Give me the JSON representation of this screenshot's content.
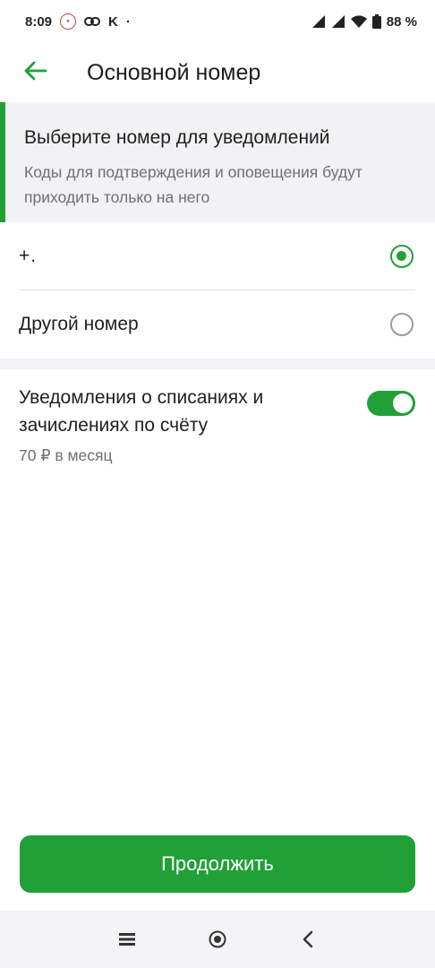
{
  "status_bar": {
    "time": "8:09",
    "carrier_letter": "K",
    "dot": "·",
    "battery": "88 %"
  },
  "header": {
    "title": "Основной номер",
    "back_icon": "arrow-left-icon"
  },
  "info": {
    "title": "Выберите номер для уведомлений",
    "description": "Коды для подтверждения и оповещения будут приходить только на него"
  },
  "options": [
    {
      "label": "+. ",
      "selected": true
    },
    {
      "label": "Другой номер",
      "selected": false
    }
  ],
  "notifications": {
    "title": "Уведомления о списаниях и зачислениях по счёту",
    "price": "70 ₽ в месяц",
    "enabled": true
  },
  "cta": {
    "label": "Продолжить"
  },
  "colors": {
    "accent": "#21a038",
    "background": "#f3f3f5",
    "text_secondary": "#6f6f74"
  },
  "system_nav": {
    "icons": [
      "menu-icon",
      "home-icon",
      "back-chevron-icon"
    ]
  }
}
